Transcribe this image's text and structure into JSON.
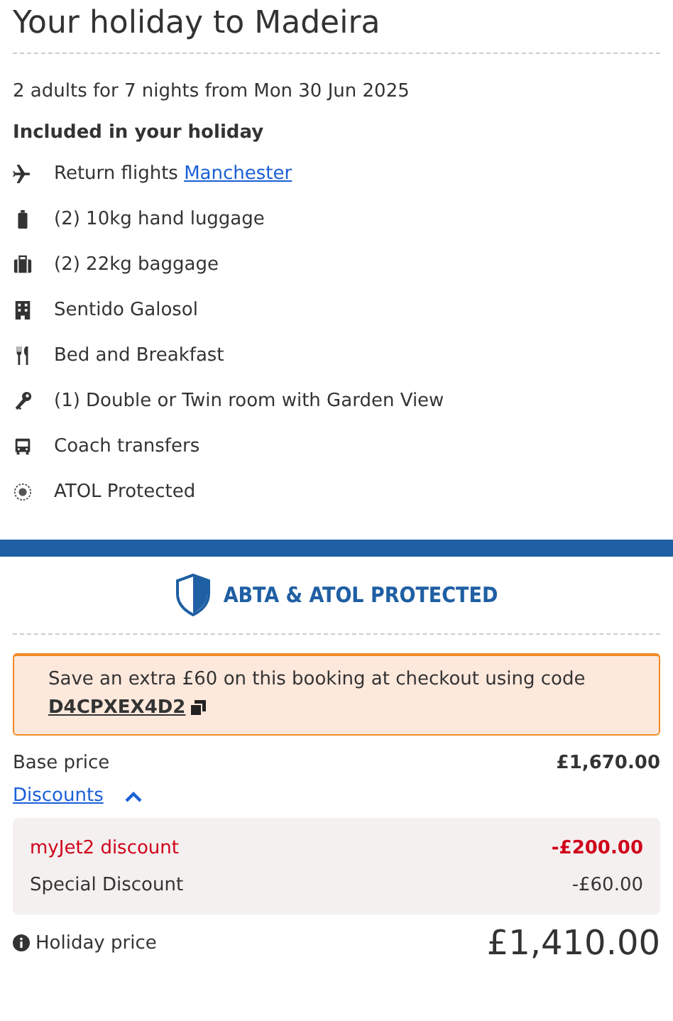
{
  "title": "Your holiday to Madeira",
  "summary": "2 adults for 7 nights from Mon 30 Jun 2025",
  "included_heading": "Included in your holiday",
  "items": [
    {
      "kind": "flight",
      "text": "Return flights ",
      "link": "Manchester"
    },
    {
      "kind": "hand-luggage",
      "text": "(2) 10kg hand luggage"
    },
    {
      "kind": "baggage",
      "text": "(2) 22kg baggage"
    },
    {
      "kind": "hotel",
      "text": "Sentido Galosol"
    },
    {
      "kind": "meal",
      "text": "Bed and Breakfast"
    },
    {
      "kind": "room",
      "text": "(1) Double or Twin room with Garden View"
    },
    {
      "kind": "transfer",
      "text": "Coach transfers"
    },
    {
      "kind": "atol",
      "text": "ATOL Protected"
    }
  ],
  "protection_banner": "ABTA & ATOL PROTECTED",
  "promo": {
    "text": "Save an extra £60 on this booking at checkout using code",
    "code": "D4CPXEX4D2"
  },
  "base_price": {
    "label": "Base price",
    "value": "£1,670.00"
  },
  "discounts": {
    "label": "Discounts",
    "expanded": true,
    "rows": [
      {
        "label": "myJet2 discount",
        "value": "-£200.00",
        "highlighted": true
      },
      {
        "label": "Special Discount",
        "value": "-£60.00",
        "highlighted": false
      }
    ]
  },
  "total": {
    "label": "Holiday price",
    "value": "£1,410.00"
  }
}
